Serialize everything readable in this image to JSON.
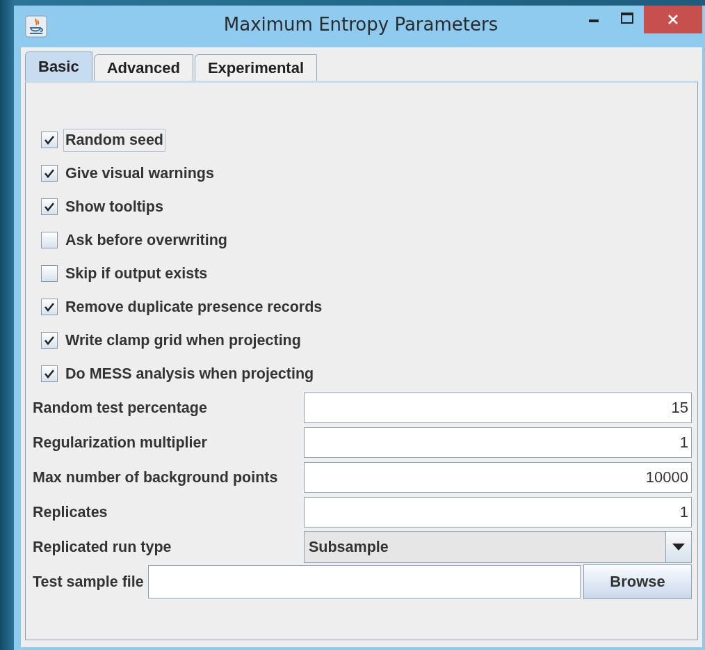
{
  "window": {
    "title": "Maximum Entropy Parameters"
  },
  "tabs": [
    {
      "label": "Basic",
      "selected": true
    },
    {
      "label": "Advanced",
      "selected": false
    },
    {
      "label": "Experimental",
      "selected": false
    }
  ],
  "options": [
    {
      "label": "Random seed",
      "checked": true,
      "focused": true
    },
    {
      "label": "Give visual warnings",
      "checked": true,
      "focused": false
    },
    {
      "label": "Show tooltips",
      "checked": true,
      "focused": false
    },
    {
      "label": "Ask before overwriting",
      "checked": false,
      "focused": false
    },
    {
      "label": "Skip if output exists",
      "checked": false,
      "focused": false
    },
    {
      "label": "Remove duplicate presence records",
      "checked": true,
      "focused": false
    },
    {
      "label": "Write clamp grid when projecting",
      "checked": true,
      "focused": false
    },
    {
      "label": "Do MESS analysis when projecting",
      "checked": true,
      "focused": false
    }
  ],
  "fields": [
    {
      "kind": "text",
      "label": "Random test percentage",
      "value": "15"
    },
    {
      "kind": "text",
      "label": "Regularization multiplier",
      "value": "1"
    },
    {
      "kind": "text",
      "label": "Max number of background points",
      "value": "10000"
    },
    {
      "kind": "text",
      "label": "Replicates",
      "value": "1"
    },
    {
      "kind": "dropdown",
      "label": "Replicated run type",
      "value": "Subsample"
    },
    {
      "kind": "file",
      "label": "Test sample file",
      "button": "Browse"
    }
  ]
}
